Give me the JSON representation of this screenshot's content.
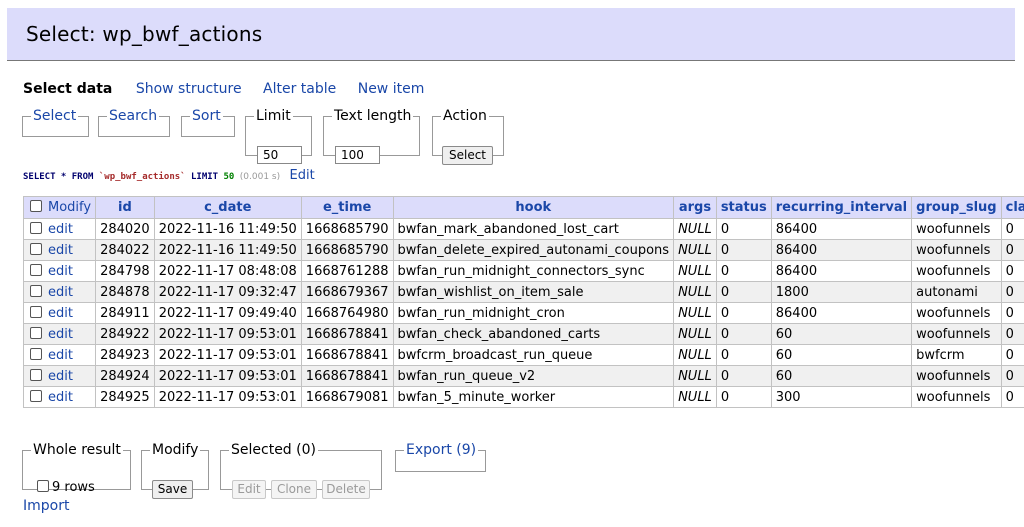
{
  "header": {
    "title": "Select: wp_bwf_actions"
  },
  "nav": {
    "select_data": "Select data",
    "show_structure": "Show structure",
    "alter_table": "Alter table",
    "new_item": "New item"
  },
  "controls": {
    "select_legend": "Select",
    "search_legend": "Search",
    "sort_legend": "Sort",
    "limit_legend": "Limit",
    "limit_value": "50",
    "text_length_legend": "Text length",
    "text_length_value": "100",
    "action_legend": "Action",
    "action_button": "Select"
  },
  "query": {
    "select": "SELECT * FROM",
    "table": "`wp_bwf_actions`",
    "limit_kw": "LIMIT",
    "limit_num": "50",
    "time": "(0.001 s)",
    "edit": "Edit"
  },
  "table": {
    "modify_header": "Modify",
    "columns": [
      "id",
      "c_date",
      "e_time",
      "hook",
      "args",
      "status",
      "recurring_interval",
      "group_slug",
      "claim_id"
    ],
    "edit_label": "edit",
    "rows": [
      [
        "284020",
        "2022-11-16 11:49:50",
        "1668685790",
        "bwfan_mark_abandoned_lost_cart",
        "NULL",
        "0",
        "86400",
        "woofunnels",
        "0"
      ],
      [
        "284022",
        "2022-11-16 11:49:50",
        "1668685790",
        "bwfan_delete_expired_autonami_coupons",
        "NULL",
        "0",
        "86400",
        "woofunnels",
        "0"
      ],
      [
        "284798",
        "2022-11-17 08:48:08",
        "1668761288",
        "bwfan_run_midnight_connectors_sync",
        "NULL",
        "0",
        "86400",
        "woofunnels",
        "0"
      ],
      [
        "284878",
        "2022-11-17 09:32:47",
        "1668679367",
        "bwfan_wishlist_on_item_sale",
        "NULL",
        "0",
        "1800",
        "autonami",
        "0"
      ],
      [
        "284911",
        "2022-11-17 09:49:40",
        "1668764980",
        "bwfan_run_midnight_cron",
        "NULL",
        "0",
        "86400",
        "woofunnels",
        "0"
      ],
      [
        "284922",
        "2022-11-17 09:53:01",
        "1668678841",
        "bwfan_check_abandoned_carts",
        "NULL",
        "0",
        "60",
        "woofunnels",
        "0"
      ],
      [
        "284923",
        "2022-11-17 09:53:01",
        "1668678841",
        "bwfcrm_broadcast_run_queue",
        "NULL",
        "0",
        "60",
        "bwfcrm",
        "0"
      ],
      [
        "284924",
        "2022-11-17 09:53:01",
        "1668678841",
        "bwfan_run_queue_v2",
        "NULL",
        "0",
        "60",
        "woofunnels",
        "0"
      ],
      [
        "284925",
        "2022-11-17 09:53:01",
        "1668679081",
        "bwfan_5_minute_worker",
        "NULL",
        "0",
        "300",
        "woofunnels",
        "0"
      ]
    ]
  },
  "footer": {
    "whole_result_legend": "Whole result",
    "rows_label": "9 rows",
    "modify_legend": "Modify",
    "save_button": "Save",
    "selected_legend": "Selected (0)",
    "edit_button": "Edit",
    "clone_button": "Clone",
    "delete_button": "Delete",
    "export_legend": "Export (9)",
    "import_link": "Import"
  }
}
